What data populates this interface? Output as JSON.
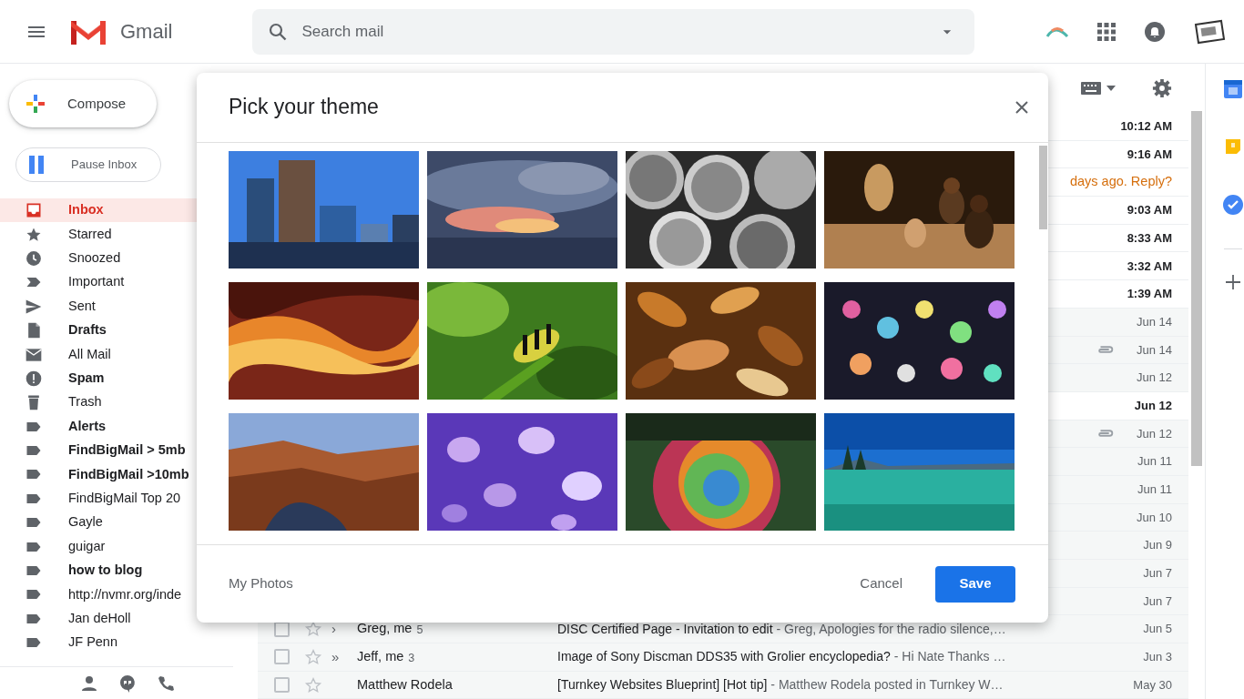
{
  "header": {
    "app_name": "Gmail",
    "search": {
      "placeholder": "Search mail"
    }
  },
  "sidebar": {
    "compose": "Compose",
    "pause": "Pause Inbox",
    "items": [
      {
        "label": "Inbox",
        "kind": "inbox",
        "bold": true,
        "selected": true
      },
      {
        "label": "Starred",
        "kind": "star",
        "bold": false,
        "selected": false
      },
      {
        "label": "Snoozed",
        "kind": "clock",
        "bold": false,
        "selected": false
      },
      {
        "label": "Important",
        "kind": "important",
        "bold": false,
        "selected": false
      },
      {
        "label": "Sent",
        "kind": "send",
        "bold": false,
        "selected": false
      },
      {
        "label": "Drafts",
        "kind": "draft",
        "bold": true,
        "selected": false
      },
      {
        "label": "All Mail",
        "kind": "mail",
        "bold": false,
        "selected": false
      },
      {
        "label": "Spam",
        "kind": "spam",
        "bold": true,
        "selected": false
      },
      {
        "label": "Trash",
        "kind": "trash",
        "bold": false,
        "selected": false
      },
      {
        "label": "Alerts",
        "kind": "label",
        "bold": true,
        "selected": false
      },
      {
        "label": "FindBigMail > 5mb",
        "kind": "label",
        "bold": true,
        "selected": false
      },
      {
        "label": "FindBigMail >10mb",
        "kind": "label",
        "bold": true,
        "selected": false
      },
      {
        "label": "FindBigMail Top 20",
        "kind": "label",
        "bold": false,
        "selected": false
      },
      {
        "label": "Gayle",
        "kind": "label",
        "bold": false,
        "selected": false
      },
      {
        "label": "guigar",
        "kind": "label",
        "bold": false,
        "selected": false
      },
      {
        "label": "how to blog",
        "kind": "label",
        "bold": true,
        "selected": false
      },
      {
        "label": "http://nvmr.org/inde",
        "kind": "label",
        "bold": false,
        "selected": false
      },
      {
        "label": "Jan deHoll",
        "kind": "label",
        "bold": false,
        "selected": false
      },
      {
        "label": "JF Penn",
        "kind": "label",
        "bold": false,
        "selected": false
      }
    ]
  },
  "mail_list": {
    "rows": [
      {
        "kind": "time",
        "time": "10:12 AM",
        "unread": true
      },
      {
        "kind": "time",
        "time": "9:16 AM",
        "unread": true
      },
      {
        "kind": "nudge",
        "nudge": "days ago. Reply?"
      },
      {
        "kind": "time",
        "time": "9:03 AM",
        "unread": true
      },
      {
        "kind": "time",
        "time": "8:33 AM",
        "unread": true
      },
      {
        "kind": "time",
        "time": "3:32 AM",
        "unread": true
      },
      {
        "kind": "time",
        "time": "1:39 AM",
        "unread": true
      },
      {
        "kind": "time",
        "time": "Jun 14",
        "unread": false
      },
      {
        "kind": "time",
        "time": "Jun 14",
        "unread": false,
        "attachment": true
      },
      {
        "kind": "time",
        "time": "Jun 12",
        "unread": false
      },
      {
        "kind": "time",
        "time": "Jun 12",
        "unread": true
      },
      {
        "kind": "time",
        "time": "Jun 12",
        "unread": false,
        "attachment": true
      },
      {
        "kind": "time",
        "time": "Jun 11",
        "unread": false
      },
      {
        "kind": "time",
        "time": "Jun 11",
        "unread": false
      },
      {
        "kind": "time",
        "time": "Jun 10",
        "unread": false
      },
      {
        "kind": "time",
        "time": "Jun 9",
        "unread": false
      },
      {
        "kind": "time",
        "time": "Jun 7",
        "unread": false
      },
      {
        "kind": "time",
        "time": "Jun 7",
        "unread": false
      },
      {
        "kind": "full",
        "sender": "Greg, me",
        "count": "5",
        "marker": "›",
        "subject": "DISC Certified Page - Invitation to edit",
        "snippet": "- Greg, Apologies for the radio silence,…",
        "time": "Jun 5",
        "unread": false
      },
      {
        "kind": "full",
        "sender": "Jeff, me",
        "count": "3",
        "marker": "»",
        "subject": "Image of Sony Discman DDS35 with Grolier encyclopedia?",
        "snippet": "- Hi Nate Thanks …",
        "time": "Jun 3",
        "unread": false
      },
      {
        "kind": "full",
        "sender": "Matthew Rodela",
        "subject": "[Turnkey Websites Blueprint] [Hot tip]",
        "snippet": "- Matthew Rodela posted in Turnkey W…",
        "time": "May 30",
        "unread": false
      }
    ]
  },
  "theme_dialog": {
    "title": "Pick your theme",
    "my_photos": "My Photos",
    "buttons": [
      {
        "label": "Cancel",
        "kind": "text"
      },
      {
        "label": "Save",
        "kind": "primary"
      }
    ]
  }
}
